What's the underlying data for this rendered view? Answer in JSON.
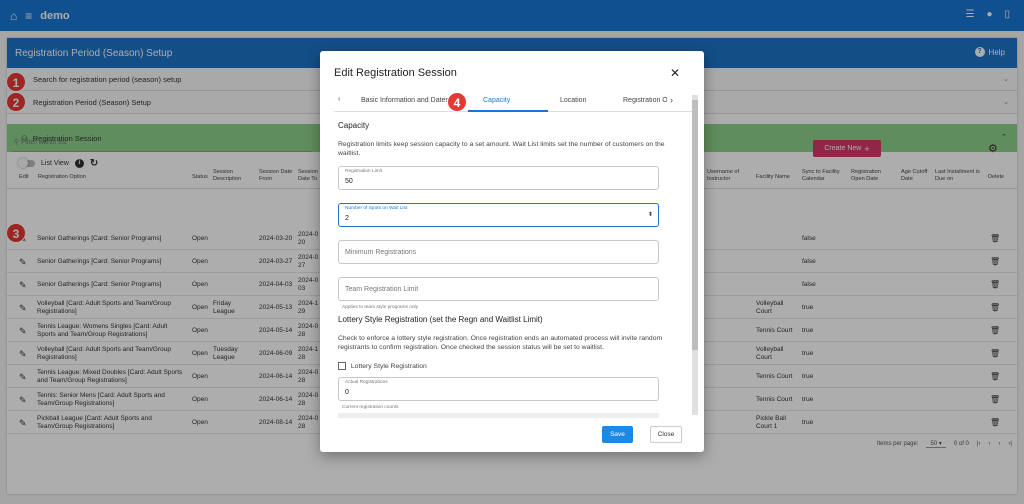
{
  "topbar": {
    "app_name": "demo"
  },
  "page": {
    "title": "Registration Period (Season) Setup",
    "help": "Help"
  },
  "accordion": [
    {
      "label": "Search for registration period (season) setup"
    },
    {
      "label": "Registration Period (Season) Setup"
    }
  ],
  "session": {
    "title": "Registration Session",
    "list_view": "List View",
    "filter_placeholder": "Filter within list",
    "create_new": "Create New"
  },
  "columns": [
    "Edit",
    "Registration Option",
    "Status",
    "Session\nDescription",
    "Session Date\nFrom",
    "Session\nDate To",
    "Username of\nInstructor",
    "Facility Name",
    "Sync to Facility\nCalendar",
    "Registration\nOpen Date",
    "Age Cutoff\nDate",
    "Last Installment is\nDue on",
    "Delete"
  ],
  "rows": [
    {
      "option": "Senior Gatherings [Card: Senior Programs]",
      "status": "Open",
      "desc": "",
      "from": "2024-03-20",
      "to": "2024-0\n20",
      "facility": "",
      "sync": "false"
    },
    {
      "option": "Senior Gatherings [Card: Senior Programs]",
      "status": "Open",
      "desc": "",
      "from": "2024-03-27",
      "to": "2024-0\n27",
      "facility": "",
      "sync": "false"
    },
    {
      "option": "Senior Gatherings [Card: Senior Programs]",
      "status": "Open",
      "desc": "",
      "from": "2024-04-03",
      "to": "2024-0\n03",
      "facility": "",
      "sync": "false"
    },
    {
      "option": "Volleyball [Card: Adult Sports and Team/Group\nRegistrations]",
      "status": "Open",
      "desc": "Friday\nLeague",
      "from": "2024-05-13",
      "to": "2024-1\n29",
      "facility": "Volleyball\nCourt",
      "sync": "true"
    },
    {
      "option": "Tennis League: Womens Singles [Card: Adult\nSports and Team/Group Registrations]",
      "status": "Open",
      "desc": "",
      "from": "2024-05-14",
      "to": "2024-0\n28",
      "facility": "Tennis Court",
      "sync": "true"
    },
    {
      "option": "Volleyball [Card: Adult Sports and Team/Group\nRegistrations]",
      "status": "Open",
      "desc": "Tuesday\nLeague",
      "from": "2024-06-09",
      "to": "2024-1\n28",
      "facility": "Volleyball\nCourt",
      "sync": "true"
    },
    {
      "option": "Tennis League: Mixed Doubles [Card: Adult Sports\nand Team/Group Registrations]",
      "status": "Open",
      "desc": "",
      "from": "2024-06-14",
      "to": "2024-0\n28",
      "facility": "Tennis Court",
      "sync": "true"
    },
    {
      "option": "Tennis: Senior Mens [Card: Adult Sports and\nTeam/Group Registrations]",
      "status": "Open",
      "desc": "",
      "from": "2024-06-14",
      "to": "2024-0\n28",
      "facility": "Tennis Court",
      "sync": "true"
    },
    {
      "option": "Pickball League [Card: Adult Sports and\nTeam/Group Registrations]",
      "status": "Open",
      "desc": "",
      "from": "2024-08-14",
      "to": "2024-0\n28",
      "facility": "Pickle Ball\nCourt 1",
      "sync": "true"
    }
  ],
  "pager": {
    "items_label": "Items per page:",
    "items_value": "50",
    "range": "0 of 0"
  },
  "callouts": [
    "1",
    "2",
    "3",
    "4"
  ],
  "modal": {
    "title": "Edit Registration Session",
    "tabs": [
      "Basic Information and Dates",
      "Capacity",
      "Location",
      "Registration O"
    ],
    "capacity_heading": "Capacity",
    "capacity_desc": "Registration limits keep session capacity to a set amount. Wait List limits set the number of customers on the waitlist.",
    "reg_limit_label": "Registration Limit",
    "reg_limit_value": "50",
    "waitlist_label": "Number of Spots on Wait List",
    "waitlist_value": "2",
    "min_reg_placeholder": "Minimum Registrations",
    "team_limit_placeholder": "Team Registration Limit",
    "team_hint": "Applies to team style programs only",
    "lottery_heading": "Lottery Style Registration (set the Regn and Waitlist Limit)",
    "lottery_desc": "Check to enforce a lottery style registration. Once registration ends an automated process will invite random registrants to confirm registration. Once checked the session status will be set to waitlist.",
    "lottery_checkbox": "Lottery Style Registration",
    "actual_label": "Actual Registrations",
    "actual_value": "0",
    "actual_hint": "Current registration counts",
    "save": "Save",
    "close": "Close"
  }
}
